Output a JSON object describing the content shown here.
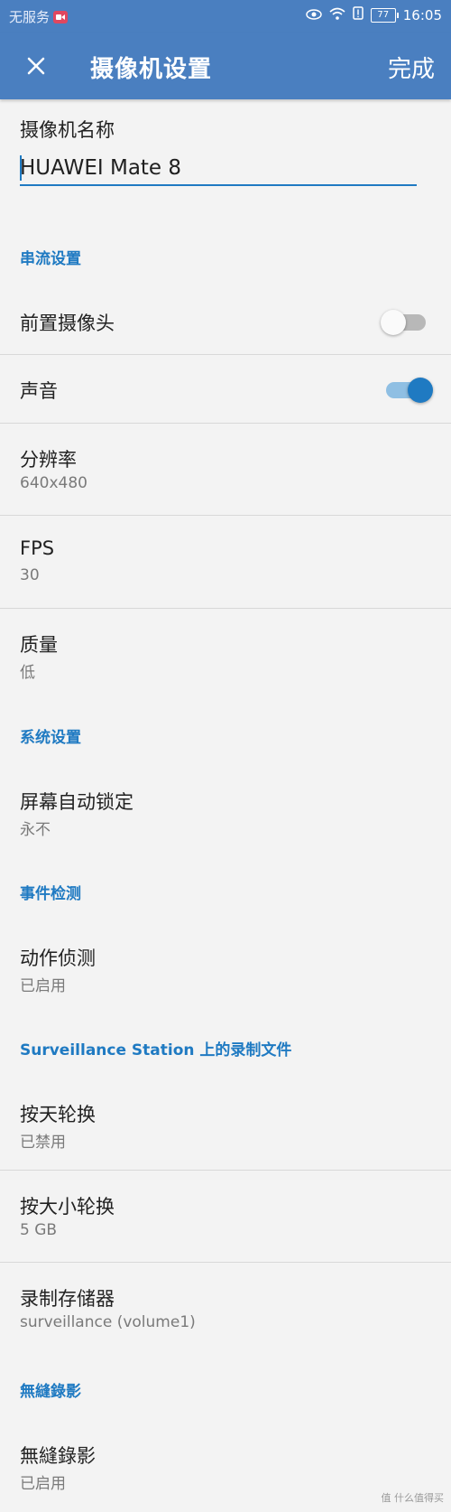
{
  "status_bar": {
    "carrier": "无服务",
    "time": "16:05",
    "battery": "77"
  },
  "app_bar": {
    "title": "摄像机设置",
    "done_label": "完成",
    "close_icon": "close-icon"
  },
  "camera_name": {
    "label": "摄像机名称",
    "value": "HUAWEI Mate 8"
  },
  "sections": {
    "streaming": "串流设置",
    "system": "系统设置",
    "event": "事件检测",
    "recording": "Surveillance Station 上的录制文件",
    "seamless": "無縫錄影"
  },
  "settings": {
    "front_camera": {
      "title": "前置摄像头",
      "enabled": false
    },
    "audio": {
      "title": "声音",
      "enabled": true
    },
    "resolution": {
      "title": "分辨率",
      "value": "640x480"
    },
    "fps": {
      "title": "FPS",
      "value": "30"
    },
    "quality": {
      "title": "质量",
      "value": "低"
    },
    "screen_lock": {
      "title": "屏幕自动锁定",
      "value": "永不"
    },
    "motion": {
      "title": "动作侦测",
      "value": "已启用"
    },
    "rotate_day": {
      "title": "按天轮换",
      "value": "已禁用"
    },
    "rotate_size": {
      "title": "按大小轮换",
      "value": "5 GB"
    },
    "storage": {
      "title": "录制存储器",
      "value": "surveillance (volume1)"
    },
    "seamless": {
      "title": "無縫錄影",
      "value": "已启用"
    }
  },
  "watermark": "值 什么值得买",
  "colors": {
    "app_bar": "#4a7fc0",
    "accent": "#1f7ac2",
    "background": "#f3f3f3"
  }
}
